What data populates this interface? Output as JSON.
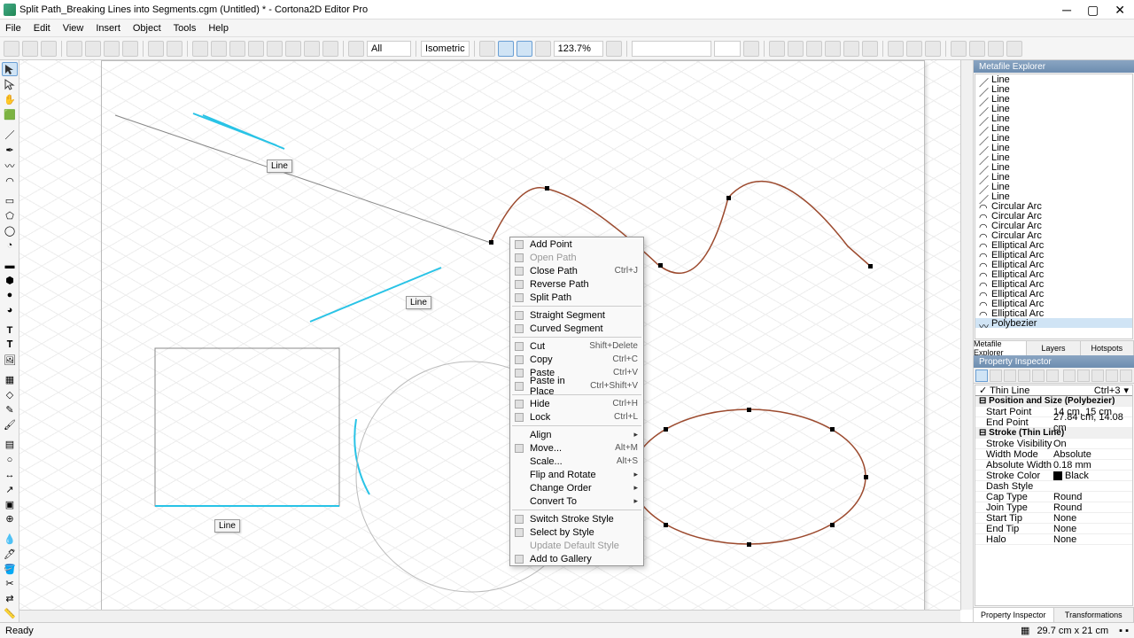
{
  "window": {
    "title": "Split Path_Breaking Lines into Segments.cgm (Untitled) * - Cortona2D Editor Pro"
  },
  "menu": {
    "items": [
      "File",
      "Edit",
      "View",
      "Insert",
      "Object",
      "Tools",
      "Help"
    ]
  },
  "toolbar": {
    "layer_combo": "All",
    "style_combo": "Isometric",
    "zoom": "123.7% "
  },
  "canvas": {
    "labels": [
      "Line",
      "Line",
      "Line"
    ]
  },
  "context_menu": {
    "items": [
      {
        "label": "Add Point",
        "icon": true
      },
      {
        "label": "Open Path",
        "icon": true,
        "disabled": true
      },
      {
        "label": "Close Path",
        "icon": true,
        "shortcut": "Ctrl+J"
      },
      {
        "label": "Reverse Path",
        "icon": true
      },
      {
        "label": "Split Path",
        "icon": true
      },
      {
        "sep": true
      },
      {
        "label": "Straight Segment",
        "icon": true
      },
      {
        "label": "Curved Segment",
        "icon": true
      },
      {
        "sep": true
      },
      {
        "label": "Cut",
        "icon": true,
        "shortcut": "Shift+Delete"
      },
      {
        "label": "Copy",
        "icon": true,
        "shortcut": "Ctrl+C"
      },
      {
        "label": "Paste",
        "icon": true,
        "shortcut": "Ctrl+V"
      },
      {
        "label": "Paste in Place",
        "icon": true,
        "shortcut": "Ctrl+Shift+V"
      },
      {
        "sep": true
      },
      {
        "label": "Hide",
        "icon": true,
        "shortcut": "Ctrl+H"
      },
      {
        "label": "Lock",
        "icon": true,
        "shortcut": "Ctrl+L"
      },
      {
        "sep": true
      },
      {
        "label": "Align",
        "sub": true
      },
      {
        "label": "Move...",
        "icon": true,
        "shortcut": "Alt+M"
      },
      {
        "label": "Scale...",
        "shortcut": "Alt+S"
      },
      {
        "label": "Flip and Rotate",
        "sub": true
      },
      {
        "label": "Change Order",
        "sub": true
      },
      {
        "label": "Convert To",
        "sub": true
      },
      {
        "sep": true
      },
      {
        "label": "Switch Stroke Style",
        "icon": true
      },
      {
        "label": "Select by Style",
        "icon": true
      },
      {
        "label": "Update Default Style",
        "disabled": true
      },
      {
        "label": "Add to Gallery",
        "icon": true
      }
    ]
  },
  "metafile_explorer": {
    "title": "Metafile Explorer",
    "items": [
      {
        "t": "Line"
      },
      {
        "t": "Line"
      },
      {
        "t": "Line"
      },
      {
        "t": "Line"
      },
      {
        "t": "Line"
      },
      {
        "t": "Line"
      },
      {
        "t": "Line"
      },
      {
        "t": "Line"
      },
      {
        "t": "Line"
      },
      {
        "t": "Line"
      },
      {
        "t": "Line"
      },
      {
        "t": "Line"
      },
      {
        "t": "Line"
      },
      {
        "t": "Circular Arc",
        "a": true
      },
      {
        "t": "Circular Arc",
        "a": true
      },
      {
        "t": "Circular Arc",
        "a": true
      },
      {
        "t": "Circular Arc",
        "a": true
      },
      {
        "t": "Elliptical Arc",
        "a": true
      },
      {
        "t": "Elliptical Arc",
        "a": true
      },
      {
        "t": "Elliptical Arc",
        "a": true
      },
      {
        "t": "Elliptical Arc",
        "a": true
      },
      {
        "t": "Elliptical Arc",
        "a": true
      },
      {
        "t": "Elliptical Arc",
        "a": true
      },
      {
        "t": "Elliptical Arc",
        "a": true
      },
      {
        "t": "Elliptical Arc",
        "a": true
      },
      {
        "t": "Polybezier",
        "sel": true,
        "b": true
      }
    ],
    "tabs": [
      "Metafile Explorer",
      "Layers",
      "Hotspots"
    ]
  },
  "property_inspector": {
    "title": "Property Inspector",
    "stroke_style": {
      "label": "Thin Line",
      "shortcut": "Ctrl+3"
    },
    "groups": [
      {
        "name": "Position and Size (Polybezier)",
        "rows": [
          {
            "l": "Start Point",
            "v": "14 cm, 15 cm"
          },
          {
            "l": "End Point",
            "v": "27.84 cm, 14.08 cm"
          }
        ]
      },
      {
        "name": "Stroke (Thin Line)",
        "rows": [
          {
            "l": "Stroke Visibility",
            "v": "On"
          },
          {
            "l": "Width Mode",
            "v": "Absolute"
          },
          {
            "l": "Absolute Width",
            "v": "0.18 mm"
          },
          {
            "l": "Stroke Color",
            "v": "Black",
            "color": "#000"
          },
          {
            "l": "Dash Style",
            "v": ""
          },
          {
            "l": "Cap Type",
            "v": "Round"
          },
          {
            "l": "Join Type",
            "v": "Round"
          },
          {
            "l": "Start Tip",
            "v": "None"
          },
          {
            "l": "End Tip",
            "v": "None"
          },
          {
            "l": "Halo",
            "v": "None"
          }
        ]
      }
    ],
    "tabs": [
      "Property Inspector",
      "Transformations"
    ]
  },
  "status": {
    "ready": "Ready",
    "dims": "29.7 cm x 21 cm"
  }
}
